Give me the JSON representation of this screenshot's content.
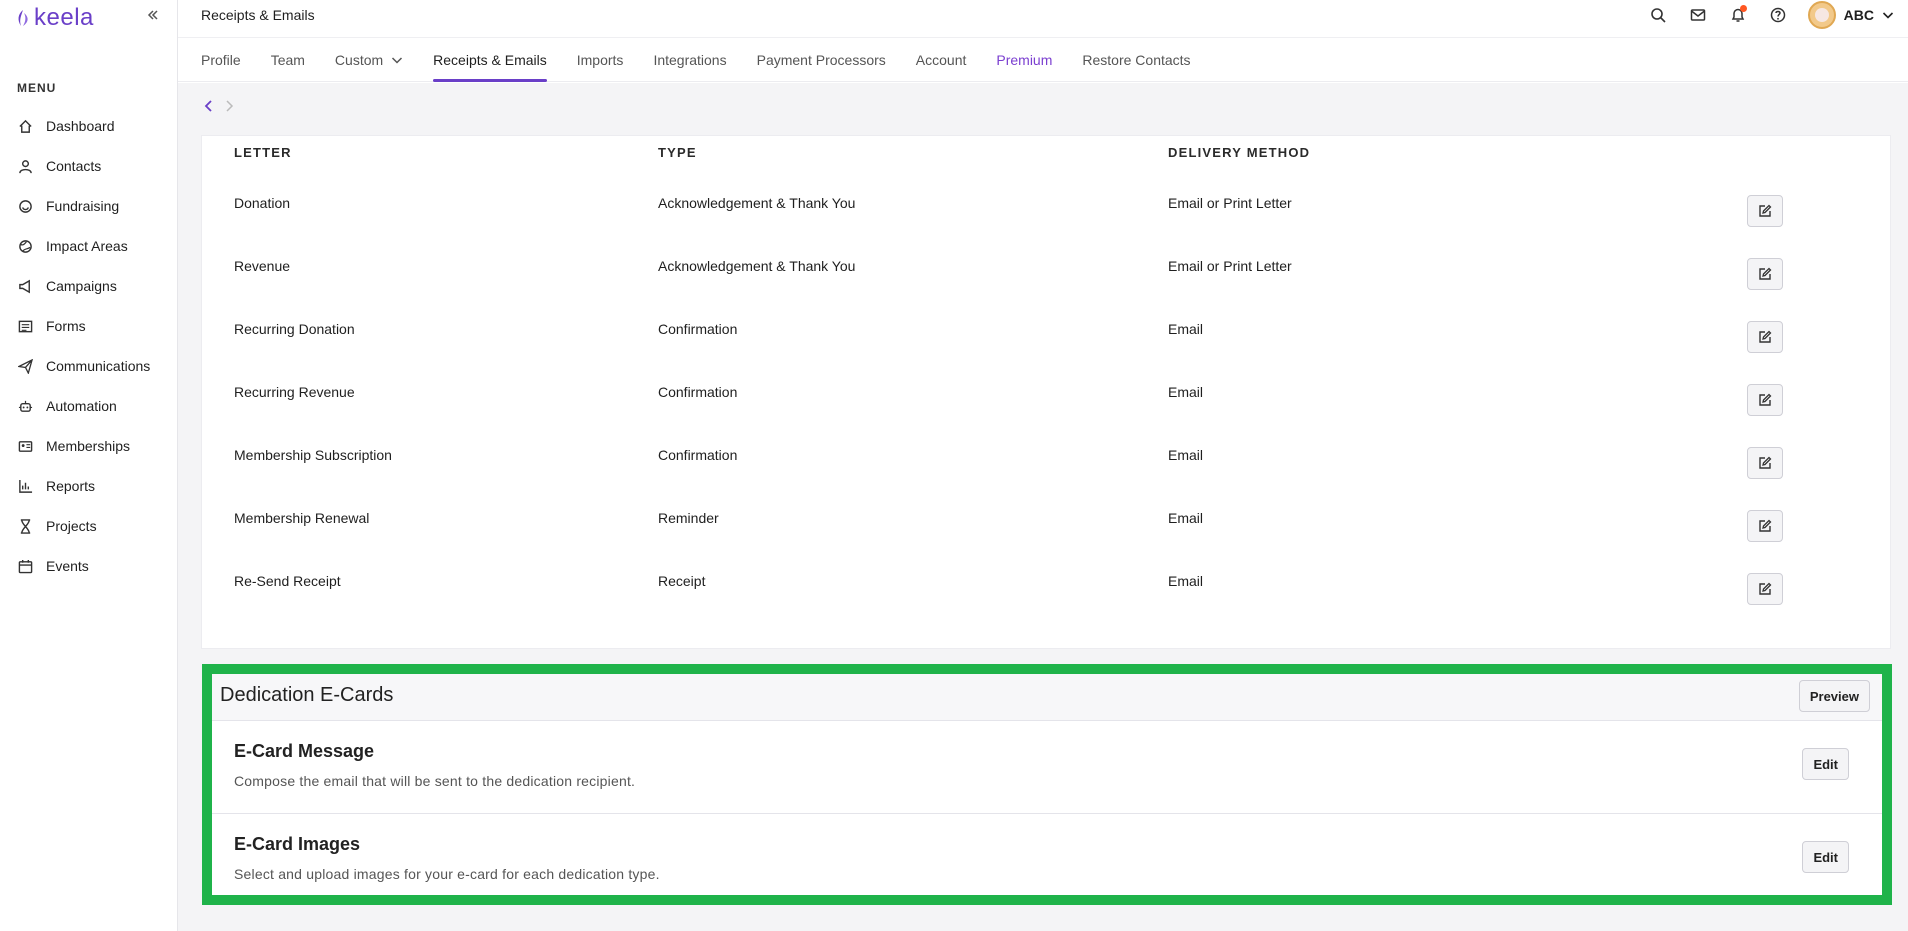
{
  "app": {
    "logo_text": "keela",
    "brand_color": "#6a3fc8"
  },
  "header": {
    "title": "Receipts & Emails",
    "icons": [
      "search-icon",
      "mail-icon",
      "bell-icon",
      "help-icon"
    ],
    "account_name": "ABC"
  },
  "sidebar": {
    "menu_title": "MENU",
    "items": [
      {
        "label": "Dashboard",
        "icon": "home-icon"
      },
      {
        "label": "Contacts",
        "icon": "user-icon"
      },
      {
        "label": "Fundraising",
        "icon": "fundraising-icon"
      },
      {
        "label": "Impact Areas",
        "icon": "globe-icon"
      },
      {
        "label": "Campaigns",
        "icon": "megaphone-icon"
      },
      {
        "label": "Forms",
        "icon": "form-icon"
      },
      {
        "label": "Communications",
        "icon": "send-icon"
      },
      {
        "label": "Automation",
        "icon": "robot-icon"
      },
      {
        "label": "Memberships",
        "icon": "id-card-icon"
      },
      {
        "label": "Reports",
        "icon": "chart-icon"
      },
      {
        "label": "Projects",
        "icon": "hourglass-icon"
      },
      {
        "label": "Events",
        "icon": "calendar-icon"
      }
    ]
  },
  "tabs": [
    {
      "label": "Profile"
    },
    {
      "label": "Team"
    },
    {
      "label": "Custom"
    },
    {
      "label": "Receipts & Emails"
    },
    {
      "label": "Imports"
    },
    {
      "label": "Integrations"
    },
    {
      "label": "Payment Processors"
    },
    {
      "label": "Account"
    },
    {
      "label": "Premium"
    },
    {
      "label": "Restore Contacts"
    }
  ],
  "letters": {
    "columns": {
      "letter": "LETTER",
      "type": "TYPE",
      "delivery": "DELIVERY METHOD"
    },
    "rows": [
      {
        "letter": "Donation",
        "type": "Acknowledgement & Thank You",
        "delivery": "Email or Print Letter"
      },
      {
        "letter": "Revenue",
        "type": "Acknowledgement & Thank You",
        "delivery": "Email or Print Letter"
      },
      {
        "letter": "Recurring Donation",
        "type": "Confirmation",
        "delivery": "Email"
      },
      {
        "letter": "Recurring Revenue",
        "type": "Confirmation",
        "delivery": "Email"
      },
      {
        "letter": "Membership Subscription",
        "type": "Confirmation",
        "delivery": "Email"
      },
      {
        "letter": "Membership Renewal",
        "type": "Reminder",
        "delivery": "Email"
      },
      {
        "letter": "Re-Send Receipt",
        "type": "Receipt",
        "delivery": "Email"
      }
    ]
  },
  "ecards": {
    "title": "Dedication E-Cards",
    "preview_label": "Preview",
    "highlight_color": "#1fb34a",
    "items": [
      {
        "name": "E-Card Message",
        "description": "Compose the email that will be sent to the dedication recipient.",
        "edit_label": "Edit"
      },
      {
        "name": "E-Card Images",
        "description": "Select and upload images for your e-card for each dedication type.",
        "edit_label": "Edit"
      }
    ]
  }
}
